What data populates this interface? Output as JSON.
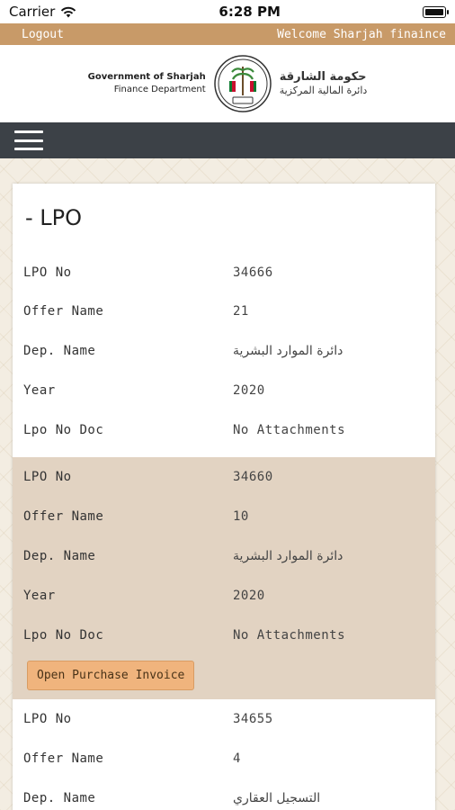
{
  "status_bar": {
    "carrier": "Carrier",
    "time": "6:28 PM"
  },
  "top_bar": {
    "logout": "Logout",
    "welcome": "Welcome Sharjah finaince"
  },
  "header": {
    "gov_en_line1": "Government of Sharjah",
    "gov_en_line2": "Finance Department",
    "gov_ar_line1": "حكومة الشارقة",
    "gov_ar_line2": "دائرة المالية المركزية",
    "emblem_icon": "sharjah-emblem-icon"
  },
  "page": {
    "title": "- LPO"
  },
  "records": [
    {
      "lpo_no_label": "LPO No",
      "lpo_no": "34666",
      "offer_name_label": "Offer Name",
      "offer_name": "21",
      "dep_name_label": "Dep. Name",
      "dep_name": "دائرة الموارد البشرية",
      "year_label": "Year",
      "year": "2020",
      "lpo_doc_label": "Lpo No Doc",
      "lpo_doc": "No Attachments"
    },
    {
      "lpo_no_label": "LPO No",
      "lpo_no": "34660",
      "offer_name_label": "Offer Name",
      "offer_name": "10",
      "dep_name_label": "Dep. Name",
      "dep_name": "دائرة الموارد البشرية",
      "year_label": "Year",
      "year": "2020",
      "lpo_doc_label": "Lpo No Doc",
      "lpo_doc": "No Attachments",
      "button_label": "Open Purchase Invoice"
    },
    {
      "lpo_no_label": "LPO No",
      "lpo_no": "34655",
      "offer_name_label": "Offer Name",
      "offer_name": "4",
      "dep_name_label": "Dep. Name",
      "dep_name": "التسجيل العقاري"
    }
  ],
  "colors": {
    "accent": "#c89a68",
    "navbar": "#3c4147",
    "alt_row": "#e2d3c2",
    "button": "#f0b47d"
  }
}
